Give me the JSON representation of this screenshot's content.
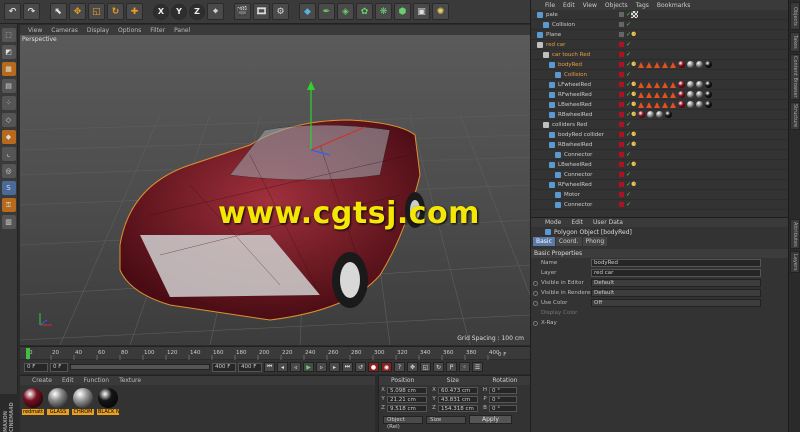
{
  "viewport": {
    "menu": [
      "View",
      "Cameras",
      "Display",
      "Options",
      "Filter",
      "Panel"
    ],
    "label": "Perspective",
    "grid_spacing": "Grid Spacing : 100 cm"
  },
  "watermark": "www.cgtsj.com",
  "timeline": {
    "ticks": [
      "0",
      "20",
      "40",
      "60",
      "80",
      "100",
      "120",
      "140",
      "160",
      "180",
      "200",
      "220",
      "240",
      "260",
      "280",
      "300",
      "320",
      "340",
      "360",
      "380",
      "400"
    ],
    "current_frame_label": "0 F"
  },
  "transport": {
    "start": "0 F",
    "current": "0 F",
    "end": "400 F",
    "end2": "400 F"
  },
  "materials": {
    "menu": [
      "Create",
      "Edit",
      "Function",
      "Texture"
    ],
    "items": [
      {
        "label": "redmatt",
        "color": "#7a1020"
      },
      {
        "label": "GLASS",
        "color": "#8a8a8a"
      },
      {
        "label": "CHROM",
        "color": "#9a9a9a"
      },
      {
        "label": "BLACK N",
        "color": "#151515"
      }
    ]
  },
  "coordinates": {
    "headers": [
      "Position",
      "Size",
      "Rotation"
    ],
    "rows": [
      {
        "axis": "X",
        "pos": "5.098 cm",
        "size": "60.473 cm",
        "rot_axis": "H",
        "rot": "0 °"
      },
      {
        "axis": "Y",
        "pos": "21.21 cm",
        "size": "43.831 cm",
        "rot_axis": "P",
        "rot": "0 °"
      },
      {
        "axis": "Z",
        "pos": "9.518 cm",
        "size": "154.318 cm",
        "rot_axis": "B",
        "rot": "0 °"
      }
    ],
    "mode": "Object (Rel)",
    "size_mode": "Size",
    "apply": "Apply"
  },
  "maxon_logo": "MAXON CINEMA4D",
  "object_manager": {
    "menu": [
      "File",
      "Edit",
      "View",
      "Objects",
      "Tags",
      "Bookmarks"
    ],
    "rows": [
      {
        "indent": 0,
        "name": "pale",
        "style": "normal",
        "icon": "#5a9ad0",
        "tags": "checker"
      },
      {
        "indent": 1,
        "name": "Collision",
        "style": "normal",
        "icon": "#5a9ad0",
        "tags": ""
      },
      {
        "indent": 0,
        "name": "Plane",
        "style": "normal",
        "icon": "#5a9ad0",
        "tags": "dots"
      },
      {
        "indent": 0,
        "name": "red car",
        "style": "orange",
        "icon": "#c0c0c0",
        "tags": ""
      },
      {
        "indent": 1,
        "name": "car touch Red",
        "style": "orange",
        "icon": "#c0c0c0",
        "tags": ""
      },
      {
        "indent": 2,
        "name": "bodyRed",
        "style": "orange",
        "icon": "#5a9ad0",
        "tags": "full"
      },
      {
        "indent": 3,
        "name": "Collision",
        "style": "orange",
        "icon": "#5a9ad0",
        "tags": ""
      },
      {
        "indent": 2,
        "name": "LFwheelRed",
        "style": "normal",
        "icon": "#5a9ad0",
        "tags": "full"
      },
      {
        "indent": 2,
        "name": "RFwheelRed",
        "style": "normal",
        "icon": "#5a9ad0",
        "tags": "full"
      },
      {
        "indent": 2,
        "name": "LBwheelRed",
        "style": "normal",
        "icon": "#5a9ad0",
        "tags": "full"
      },
      {
        "indent": 2,
        "name": "RBwheelRed",
        "style": "normal",
        "icon": "#5a9ad0",
        "tags": "balls"
      },
      {
        "indent": 1,
        "name": "colliders Red",
        "style": "normal",
        "icon": "#c0c0c0",
        "tags": ""
      },
      {
        "indent": 2,
        "name": "bodyRed collider",
        "style": "normal",
        "icon": "#5a9ad0",
        "tags": "dots"
      },
      {
        "indent": 2,
        "name": "RBwheelRed",
        "style": "normal",
        "icon": "#5a9ad0",
        "tags": "dots"
      },
      {
        "indent": 3,
        "name": "Connector",
        "style": "normal",
        "icon": "#5a9ad0",
        "tags": ""
      },
      {
        "indent": 2,
        "name": "LBwheelRed",
        "style": "normal",
        "icon": "#5a9ad0",
        "tags": "dots"
      },
      {
        "indent": 3,
        "name": "Connector",
        "style": "normal",
        "icon": "#5a9ad0",
        "tags": ""
      },
      {
        "indent": 2,
        "name": "RFwheelRed",
        "style": "normal",
        "icon": "#5a9ad0",
        "tags": "dots"
      },
      {
        "indent": 3,
        "name": "Motor",
        "style": "normal",
        "icon": "#5a9ad0",
        "tags": ""
      },
      {
        "indent": 3,
        "name": "Connector",
        "style": "normal",
        "icon": "#5a9ad0",
        "tags": ""
      }
    ]
  },
  "attribute_manager": {
    "menu": [
      "Mode",
      "Edit",
      "User Data"
    ],
    "title": "Polygon Object [bodyRed]",
    "tabs": [
      "Basic",
      "Coord.",
      "Phong"
    ],
    "section": "Basic Properties",
    "props": [
      {
        "label": "Name",
        "value": "bodyRed",
        "type": "field",
        "radio": false,
        "disabled": false
      },
      {
        "label": "Layer",
        "value": "red car",
        "type": "field",
        "radio": false,
        "disabled": false
      },
      {
        "label": "Visible in Editor",
        "value": "Default",
        "type": "drop",
        "radio": true,
        "disabled": false
      },
      {
        "label": "Visible in Renderer",
        "value": "Default",
        "type": "drop",
        "radio": true,
        "disabled": false
      },
      {
        "label": "Use Color",
        "value": "Off",
        "type": "drop",
        "radio": true,
        "disabled": false
      },
      {
        "label": "Display Color",
        "value": "",
        "type": "none",
        "radio": false,
        "disabled": true
      },
      {
        "label": "X-Ray",
        "value": "",
        "type": "none",
        "radio": true,
        "disabled": false
      }
    ]
  },
  "side_tabs": [
    "Objects",
    "Takes",
    "Content Browser",
    "Structure",
    "Attributes",
    "Layers"
  ]
}
